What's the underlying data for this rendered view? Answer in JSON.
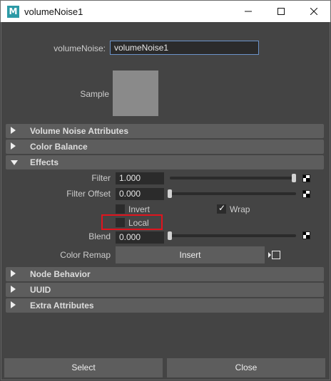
{
  "window": {
    "title": "volumeNoise1",
    "app_icon_letter": "M"
  },
  "header": {
    "node_label": "volumeNoise:",
    "node_name": "volumeNoise1",
    "sample_label": "Sample"
  },
  "sections": {
    "volume_noise": "Volume Noise Attributes",
    "color_balance": "Color Balance",
    "effects": "Effects",
    "node_behavior": "Node Behavior",
    "uuid": "UUID",
    "extra_attributes": "Extra Attributes"
  },
  "effects": {
    "filter_label": "Filter",
    "filter_value": "1.000",
    "filter_slider": 1.0,
    "filter_offset_label": "Filter Offset",
    "filter_offset_value": "0.000",
    "filter_offset_slider": 0.0,
    "invert_label": "Invert",
    "invert_checked": false,
    "wrap_label": "Wrap",
    "wrap_checked": true,
    "local_label": "Local",
    "local_checked": false,
    "blend_label": "Blend",
    "blend_value": "0.000",
    "blend_slider": 0.0,
    "color_remap_label": "Color Remap",
    "insert_label": "Insert"
  },
  "buttons": {
    "select_label": "Select",
    "close_label": "Close"
  },
  "colors": {
    "highlight": "#e0141e",
    "background": "#444444",
    "section_header": "#5d5d5d"
  }
}
